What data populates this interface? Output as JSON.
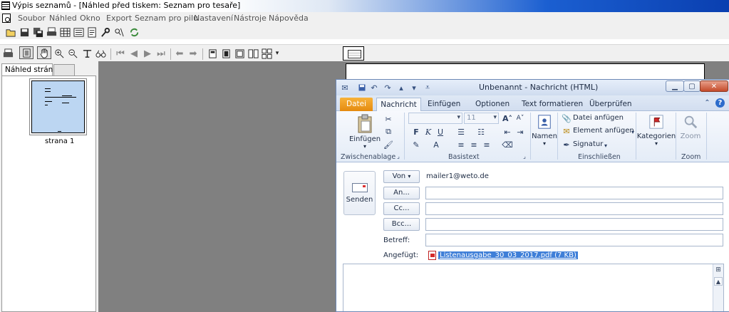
{
  "window": {
    "title": "Výpis seznamů - [Náhled před tiskem: Seznam pro tesaře]"
  },
  "menu": [
    {
      "id": "soubor",
      "label": "Soubor"
    },
    {
      "id": "nahled",
      "label": "Náhled"
    },
    {
      "id": "okno",
      "label": "Okno"
    },
    {
      "id": "export",
      "label": "Export"
    },
    {
      "id": "seznam",
      "label": "Seznam pro pilu"
    },
    {
      "id": "nastaveni",
      "label": "Nastavení"
    },
    {
      "id": "nastroje",
      "label": "Nástroje"
    },
    {
      "id": "napoveda",
      "label": "Nápověda"
    }
  ],
  "left_pane": {
    "tab_label": "Náhled stránky",
    "page_label": "strana 1"
  },
  "outlook": {
    "title": "Unbenannt - Nachricht (HTML)",
    "tabs": [
      {
        "id": "datei",
        "label": "Datei"
      },
      {
        "id": "nachricht",
        "label": "Nachricht"
      },
      {
        "id": "einfuegen",
        "label": "Einfügen"
      },
      {
        "id": "optionen",
        "label": "Optionen"
      },
      {
        "id": "text-formatieren",
        "label": "Text formatieren"
      },
      {
        "id": "ueberpruefen",
        "label": "Überprüfen"
      }
    ],
    "ribbon": {
      "paste_label": "Einfügen",
      "font_size": "11",
      "names_label": "Namen",
      "attach_file": "Datei anfügen",
      "attach_item": "Element anfügen",
      "signature": "Signatur",
      "categories": "Kategorien",
      "zoom": "Zoom",
      "groups": {
        "clipboard": "Zwischenablage",
        "basic_text": "Basistext",
        "include": "Einschließen",
        "zoom": "Zoom"
      }
    },
    "send_label": "Senden",
    "header": {
      "from_label": "Von",
      "from_value": "mailer1@weto.de",
      "to_label": "An...",
      "cc_label": "Cc...",
      "bcc_label": "Bcc...",
      "subject_label": "Betreff:",
      "attached_label": "Angefügt:",
      "attachment": "Listenausgabe_30_03_2017.pdf (7 KB)"
    }
  }
}
